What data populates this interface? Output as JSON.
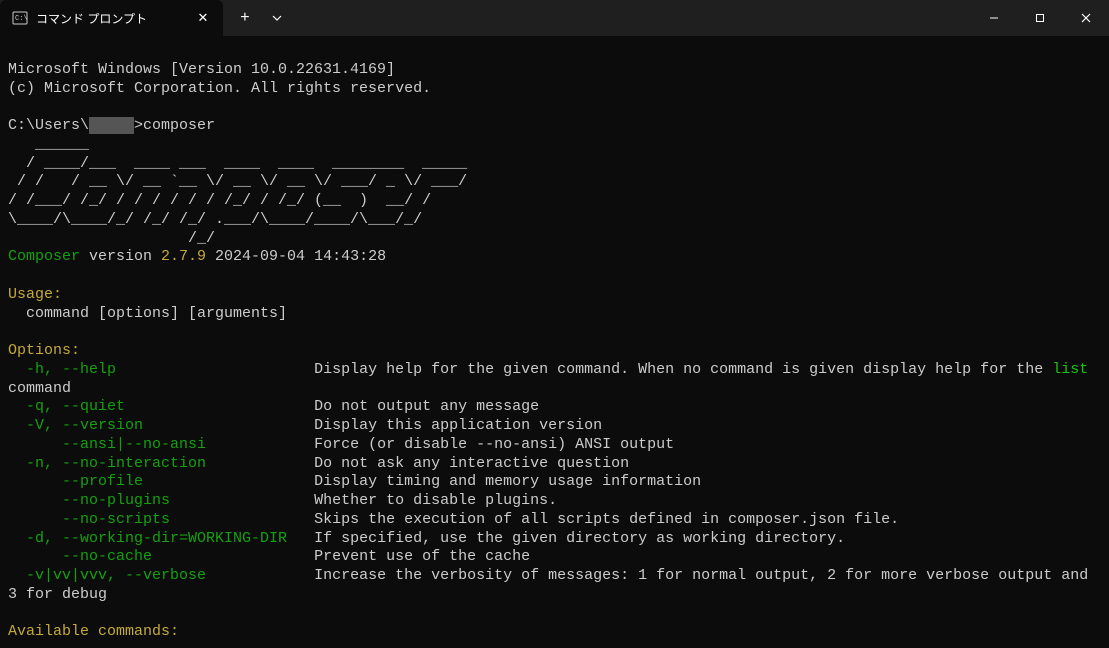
{
  "titlebar": {
    "tab_title": "コマンド プロンプト"
  },
  "banner": {
    "line1": "Microsoft Windows [Version 10.0.22631.4169]",
    "line2": "(c) Microsoft Corporation. All rights reserved."
  },
  "prompt": {
    "path_prefix": "C:\\Users\\",
    "user_mask": "     ",
    "path_suffix": ">",
    "command": "composer"
  },
  "ascii": {
    "l1": "   ______",
    "l2": "  / ____/___  ____ ___  ____  ____  ________  _____",
    "l3": " / /   / __ \\/ __ `__ \\/ __ \\/ __ \\/ ___/ _ \\/ ___/",
    "l4": "/ /___/ /_/ / / / / / / /_/ / /_/ (__  )  __/ /",
    "l5": "\\____/\\____/_/ /_/ /_/ .___/\\____/____/\\___/_/",
    "l6": "                    /_/"
  },
  "version_line": {
    "name": "Composer",
    "word": " version ",
    "ver": "2.7.9",
    "date": " 2024-09-04 14:43:28"
  },
  "usage": {
    "header": "Usage:",
    "line": "  command [options] [arguments]"
  },
  "options_header": "Options:",
  "options": [
    {
      "flags": "  -h, --help",
      "pad": "                      ",
      "desc_pre": "Display help for the given command. When no command is given display help for the ",
      "desc_hl": "list",
      "desc_post": ""
    },
    {
      "flags": "",
      "pad": "",
      "desc_pre": "command",
      "desc_hl": "",
      "desc_post": ""
    },
    {
      "flags": "  -q, --quiet",
      "pad": "                     ",
      "desc_pre": "Do not output any message",
      "desc_hl": "",
      "desc_post": ""
    },
    {
      "flags": "  -V, --version",
      "pad": "                   ",
      "desc_pre": "Display this application version",
      "desc_hl": "",
      "desc_post": ""
    },
    {
      "flags": "      --ansi|--no-ansi",
      "pad": "            ",
      "desc_pre": "Force (or disable --no-ansi) ANSI output",
      "desc_hl": "",
      "desc_post": ""
    },
    {
      "flags": "  -n, --no-interaction",
      "pad": "            ",
      "desc_pre": "Do not ask any interactive question",
      "desc_hl": "",
      "desc_post": ""
    },
    {
      "flags": "      --profile",
      "pad": "                   ",
      "desc_pre": "Display timing and memory usage information",
      "desc_hl": "",
      "desc_post": ""
    },
    {
      "flags": "      --no-plugins",
      "pad": "                ",
      "desc_pre": "Whether to disable plugins.",
      "desc_hl": "",
      "desc_post": ""
    },
    {
      "flags": "      --no-scripts",
      "pad": "                ",
      "desc_pre": "Skips the execution of all scripts defined in composer.json file.",
      "desc_hl": "",
      "desc_post": ""
    },
    {
      "flags": "  -d, --working-dir=WORKING-DIR",
      "pad": "   ",
      "desc_pre": "If specified, use the given directory as working directory.",
      "desc_hl": "",
      "desc_post": ""
    },
    {
      "flags": "      --no-cache",
      "pad": "                  ",
      "desc_pre": "Prevent use of the cache",
      "desc_hl": "",
      "desc_post": ""
    },
    {
      "flags": "  -v|vv|vvv, --verbose",
      "pad": "            ",
      "desc_pre": "Increase the verbosity of messages: 1 for normal output, 2 for more verbose output and",
      "desc_hl": "",
      "desc_post": ""
    },
    {
      "flags": "",
      "pad": "",
      "desc_pre": "3 for debug",
      "desc_hl": "",
      "desc_post": ""
    }
  ],
  "available_header": "Available commands:"
}
